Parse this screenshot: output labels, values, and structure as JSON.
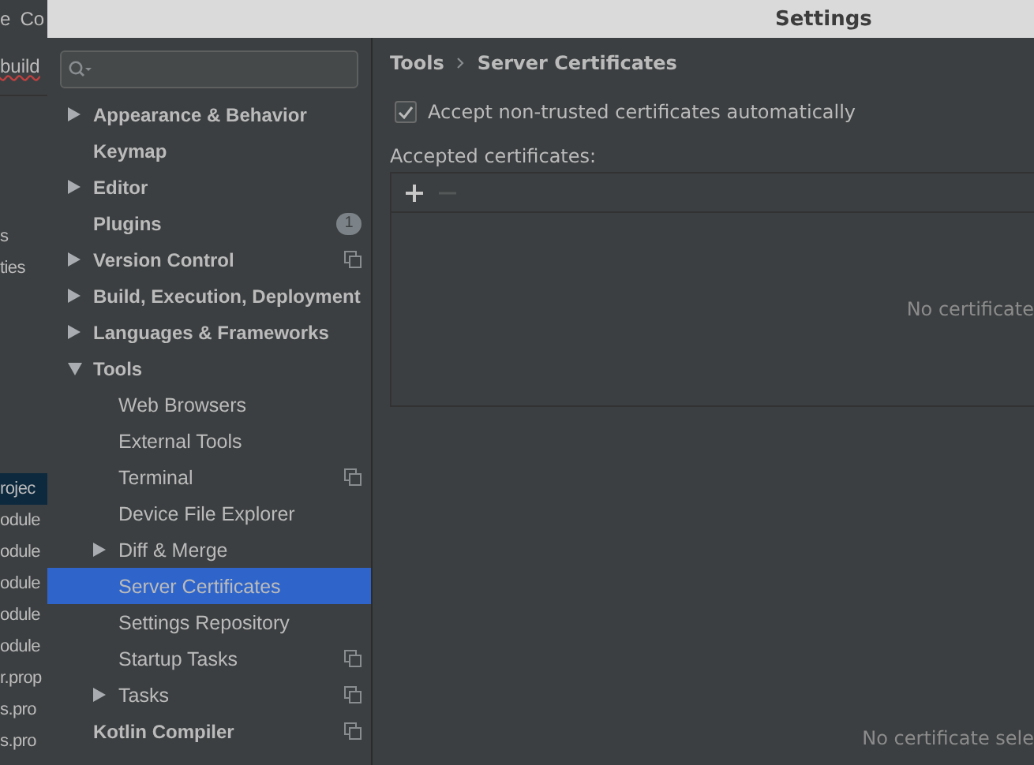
{
  "background_ide": {
    "menu": [
      "e",
      "Co"
    ],
    "editor_tab": "build",
    "project_rows": [
      {
        "label": "s",
        "selected": false
      },
      {
        "label": "ties",
        "selected": false
      },
      {
        "label": "rojec",
        "selected": true
      },
      {
        "label": "odule",
        "selected": false
      },
      {
        "label": "odule",
        "selected": false
      },
      {
        "label": "odule",
        "selected": false
      },
      {
        "label": "odule",
        "selected": false
      },
      {
        "label": "odule",
        "selected": false
      },
      {
        "label": "r.prop",
        "selected": false
      },
      {
        "label": "s.pro",
        "selected": false
      },
      {
        "label": "s.pro",
        "selected": false
      }
    ]
  },
  "window": {
    "title": "Settings"
  },
  "sidebar": {
    "items": [
      {
        "label": "Appearance & Behavior",
        "expanded": false,
        "selected": false,
        "project_scoped": false
      },
      {
        "label": "Keymap",
        "selected": false,
        "project_scoped": false
      },
      {
        "label": "Editor",
        "expanded": false,
        "selected": false,
        "project_scoped": false
      },
      {
        "label": "Plugins",
        "selected": false,
        "project_scoped": false,
        "badge": "1"
      },
      {
        "label": "Version Control",
        "expanded": false,
        "selected": false,
        "project_scoped": true
      },
      {
        "label": "Build, Execution, Deployment",
        "expanded": false,
        "selected": false,
        "project_scoped": false
      },
      {
        "label": "Languages & Frameworks",
        "expanded": false,
        "selected": false,
        "project_scoped": false
      },
      {
        "label": "Tools",
        "expanded": true,
        "selected": false,
        "project_scoped": false,
        "children": [
          {
            "label": "Web Browsers",
            "selected": false,
            "project_scoped": false
          },
          {
            "label": "External Tools",
            "selected": false,
            "project_scoped": false
          },
          {
            "label": "Terminal",
            "selected": false,
            "project_scoped": true
          },
          {
            "label": "Device File Explorer",
            "selected": false,
            "project_scoped": false
          },
          {
            "label": "Diff & Merge",
            "expanded": false,
            "selected": false,
            "project_scoped": false
          },
          {
            "label": "Server Certificates",
            "selected": true,
            "project_scoped": false
          },
          {
            "label": "Settings Repository",
            "selected": false,
            "project_scoped": false
          },
          {
            "label": "Startup Tasks",
            "selected": false,
            "project_scoped": true
          },
          {
            "label": "Tasks",
            "expanded": false,
            "selected": false,
            "project_scoped": true
          }
        ]
      },
      {
        "label": "Kotlin Compiler",
        "selected": false,
        "project_scoped": true
      }
    ]
  },
  "breadcrumb": [
    "Tools",
    "Server Certificates"
  ],
  "accept_checkbox": {
    "label": "Accept non-trusted certificates automatically",
    "checked": true
  },
  "certificates": {
    "label": "Accepted certificates:",
    "add_enabled": true,
    "remove_enabled": false,
    "empty_text": "No certificate"
  },
  "details": {
    "empty_text": "No certificate sele"
  }
}
